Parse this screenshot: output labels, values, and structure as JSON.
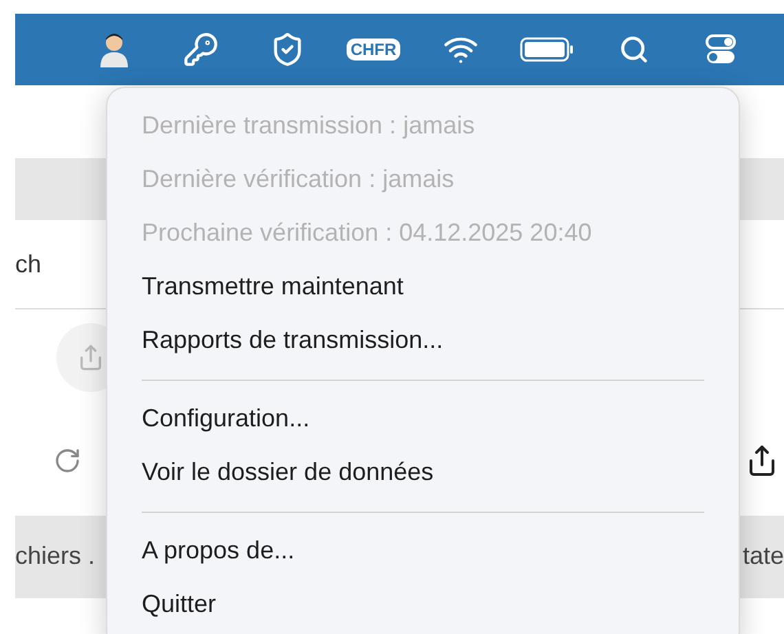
{
  "menubar": {
    "badge": "CHFR"
  },
  "background": {
    "search_fragment": "ch",
    "left_label": "chiers .",
    "right_label": "tate"
  },
  "menu": {
    "items": [
      {
        "kind": "item",
        "label": "Dernière transmission : jamais",
        "disabled": true
      },
      {
        "kind": "item",
        "label": "Dernière vérification : jamais",
        "disabled": true
      },
      {
        "kind": "item",
        "label": "Prochaine vérification : 04.12.2025 20:40",
        "disabled": true
      },
      {
        "kind": "item",
        "label": "Transmettre maintenant",
        "disabled": false
      },
      {
        "kind": "item",
        "label": "Rapports de transmission...",
        "disabled": false
      },
      {
        "kind": "separator"
      },
      {
        "kind": "item",
        "label": "Configuration...",
        "disabled": false
      },
      {
        "kind": "item",
        "label": "Voir le dossier de données",
        "disabled": false
      },
      {
        "kind": "separator"
      },
      {
        "kind": "item",
        "label": "A propos de...",
        "disabled": false
      },
      {
        "kind": "item",
        "label": "Quitter",
        "disabled": false
      }
    ]
  }
}
